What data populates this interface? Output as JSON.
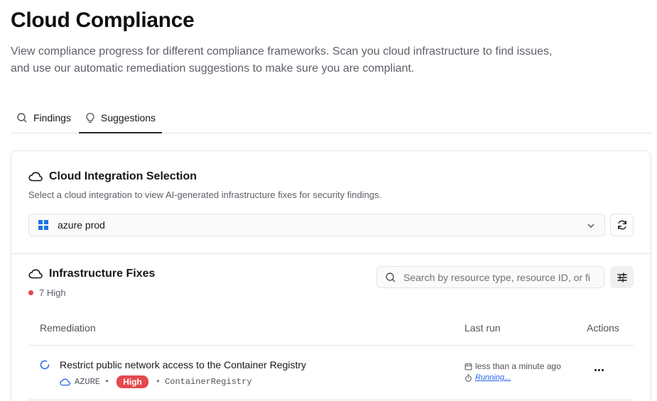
{
  "page": {
    "title": "Cloud Compliance",
    "description": "View compliance progress for different compliance frameworks. Scan you cloud infrastructure to find issues, and use our automatic remediation suggestions to make sure you are compliant."
  },
  "tabs": [
    {
      "label": "Findings",
      "icon": "search-icon",
      "active": false
    },
    {
      "label": "Suggestions",
      "icon": "lightbulb-icon",
      "active": true
    }
  ],
  "integration": {
    "title": "Cloud Integration Selection",
    "icon": "cloud-icon",
    "description": "Select a cloud integration to view AI-generated infrastructure fixes for security findings.",
    "selected": "azure prod",
    "selected_icon": "windows-logo-icon"
  },
  "fixes": {
    "title": "Infrastructure Fixes",
    "icon": "cloud-icon",
    "severity_summary": "7 High",
    "search_placeholder": "Search by resource type, resource ID, or fi",
    "columns": {
      "remediation": "Remediation",
      "last_run": "Last run",
      "actions": "Actions"
    },
    "rows": [
      {
        "title": "Restrict public network access to the Container Registry",
        "provider": "AZURE",
        "severity": "High",
        "resource": "ContainerRegistry",
        "last_run": "less than a minute ago",
        "status": "Running..."
      }
    ]
  },
  "colors": {
    "accent": "#1b74e4",
    "severity_high": "#e5484d",
    "link": "#2563eb"
  }
}
